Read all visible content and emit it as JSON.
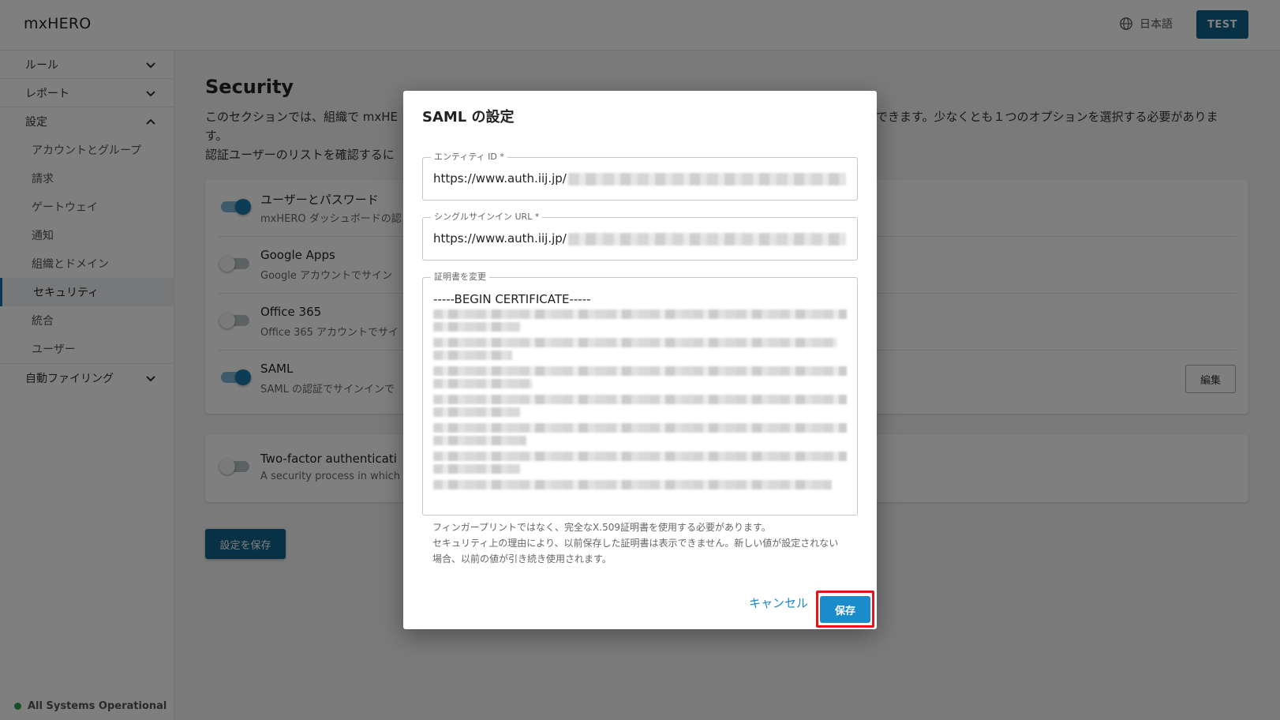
{
  "app": {
    "brand": "mxHERO",
    "language": "日本語",
    "env_button": "TEST"
  },
  "sidebar": {
    "groups": [
      {
        "label": "ルール"
      },
      {
        "label": "レポート"
      },
      {
        "label": "設定",
        "items": [
          "アカウントとグループ",
          "請求",
          "ゲートウェイ",
          "通知",
          "組織とドメイン",
          "セキュリティ",
          "統合",
          "ユーザー"
        ]
      },
      {
        "label": "自動ファイリング"
      }
    ],
    "status": "All Systems Operational"
  },
  "main": {
    "title": "Security",
    "description_line1": "このセクションでは、組織で mxHE",
    "description_line1_right": "できます。少なくとも１つのオプションを選択する必要がありま",
    "description_line2": "す。",
    "description_line3": "認証ユーザーのリストを確認するに",
    "options": [
      {
        "title": "ユーザーとパスワード",
        "sub": "mxHERO ダッシュボードの認",
        "enabled": true
      },
      {
        "title": "Google Apps",
        "sub": "Google アカウントでサイン",
        "enabled": false
      },
      {
        "title": "Office 365",
        "sub": "Office 365 アカウントでサイ",
        "enabled": false
      },
      {
        "title": "SAML",
        "sub": "SAML の認証でサインインで",
        "enabled": true,
        "edit_label": "編集"
      }
    ],
    "two_factor": {
      "title": "Two-factor authenticati",
      "sub": "A security process in which",
      "enabled": false
    },
    "save_settings": "設定を保存"
  },
  "modal": {
    "title": "SAML の設定",
    "entity_id": {
      "label": "エンティティ ID *",
      "value": "https://www.auth.iij.jp/"
    },
    "sso_url": {
      "label": "シングルサインイン URL *",
      "value": "https://www.auth.iij.jp/"
    },
    "certificate": {
      "label": "証明書を変更",
      "begin": "-----BEGIN CERTIFICATE-----"
    },
    "helper_line1": "フィンガープリントではなく、完全なX.509証明書を使用する必要があります。",
    "helper_line2": "セキュリティ上の理由により、以前保存した証明書は表示できません。新しい値が設定されない",
    "helper_line3": "場合、以前の値が引き続き使用されます。",
    "cancel": "キャンセル",
    "save": "保存"
  },
  "colors": {
    "primary": "#12638a",
    "accent": "#1a8ccc",
    "highlight": "#e0161c",
    "status_ok": "#27a047"
  }
}
